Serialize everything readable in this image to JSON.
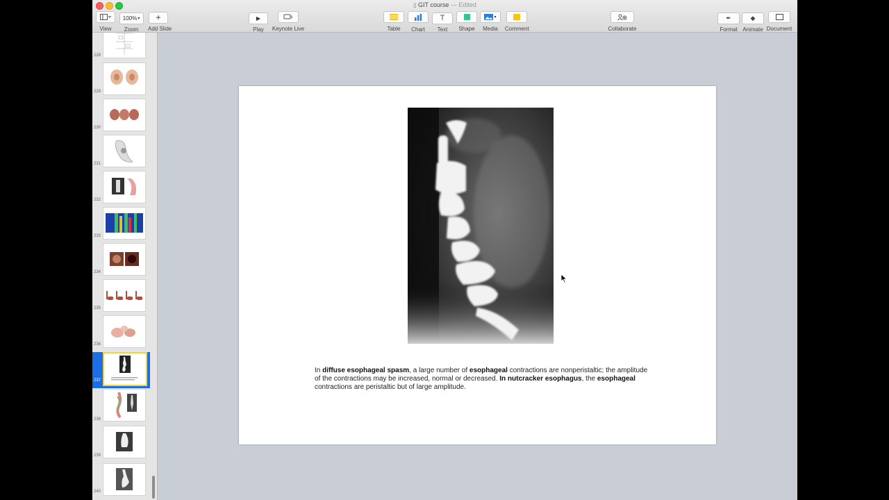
{
  "window": {
    "title": "GIT course",
    "status": "Edited"
  },
  "toolbar": {
    "view": "View",
    "zoom": "Zoom",
    "zoom_value": "100%",
    "add_slide": "Add Slide",
    "play": "Play",
    "keynote_live": "Keynote Live",
    "table": "Table",
    "chart": "Chart",
    "text": "Text",
    "shape": "Shape",
    "media": "Media",
    "comment": "Comment",
    "collaborate": "Collaborate",
    "format": "Format",
    "animate": "Animate",
    "document": "Document"
  },
  "sidebar": {
    "slides": [
      {
        "num": "228",
        "kind": "diagram"
      },
      {
        "num": "229",
        "kind": "anatomy"
      },
      {
        "num": "230",
        "kind": "anatomy"
      },
      {
        "num": "231",
        "kind": "diagram"
      },
      {
        "num": "232",
        "kind": "mixed"
      },
      {
        "num": "233",
        "kind": "manometry"
      },
      {
        "num": "234",
        "kind": "endoscopy"
      },
      {
        "num": "235",
        "kind": "anatomy"
      },
      {
        "num": "236",
        "kind": "anatomy"
      },
      {
        "num": "237",
        "kind": "xray",
        "selected": true
      },
      {
        "num": "238",
        "kind": "mixed"
      },
      {
        "num": "239",
        "kind": "xray"
      },
      {
        "num": "240",
        "kind": "xray"
      }
    ]
  },
  "slide": {
    "caption": {
      "p1": "In ",
      "b1": "diffuse esophageal spasm",
      "p2": ", a large number of ",
      "b2": "esophageal",
      "p3": " contractions are nonperistaltic; the amplitude of the contractions may be increased, normal or decreased. ",
      "b3": "In nutcracker esophagus",
      "p4": ", the ",
      "b4": "esophageal",
      "p5": " contractions are peristaltic but of large amplitude."
    }
  }
}
